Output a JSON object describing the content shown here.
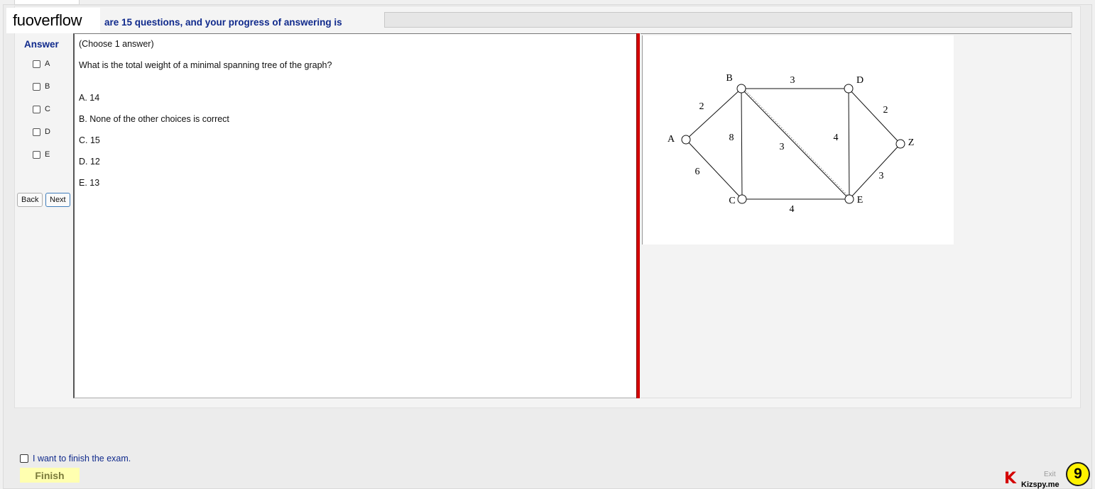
{
  "brand": {
    "name": "fuoverflow"
  },
  "header": {
    "progress_text": "are 15 questions, and your progress of answering is",
    "progress_fraction": 0
  },
  "answer_panel": {
    "label": "Answer",
    "options": [
      "A",
      "B",
      "C",
      "D",
      "E"
    ],
    "back_label": "Back",
    "next_label": "Next"
  },
  "question": {
    "instruction": "(Choose 1 answer)",
    "text": "What is the total weight of a minimal spanning tree of the graph?",
    "choices": [
      "A.  14",
      "B.  None of the other choices is correct",
      "C.  15",
      "D.  12",
      "E.  13"
    ]
  },
  "graph": {
    "nodes": [
      {
        "id": "A",
        "label": "A"
      },
      {
        "id": "B",
        "label": "B"
      },
      {
        "id": "C",
        "label": "C"
      },
      {
        "id": "D",
        "label": "D"
      },
      {
        "id": "E",
        "label": "E"
      },
      {
        "id": "Z",
        "label": "Z"
      }
    ],
    "edges": [
      {
        "from": "A",
        "to": "B",
        "weight": "2"
      },
      {
        "from": "A",
        "to": "C",
        "weight": "6"
      },
      {
        "from": "B",
        "to": "C",
        "weight": "8"
      },
      {
        "from": "B",
        "to": "D",
        "weight": "3"
      },
      {
        "from": "B",
        "to": "E",
        "weight": "3"
      },
      {
        "from": "D",
        "to": "E",
        "weight": "4"
      },
      {
        "from": "D",
        "to": "Z",
        "weight": "2"
      },
      {
        "from": "C",
        "to": "E",
        "weight": "4"
      },
      {
        "from": "E",
        "to": "Z",
        "weight": "3"
      }
    ]
  },
  "footer": {
    "finish_checkbox_label": "I want to finish the exam.",
    "finish_button": "Finish",
    "exit_label": "Exit",
    "kizspy_text": "Kizspy.me",
    "kizspy_k": "K",
    "badge_number": "9"
  },
  "colors": {
    "accent": "#102a8c",
    "divider": "#d40000",
    "finish_bg": "#ffffb0",
    "badge_bg": "#fff200"
  }
}
